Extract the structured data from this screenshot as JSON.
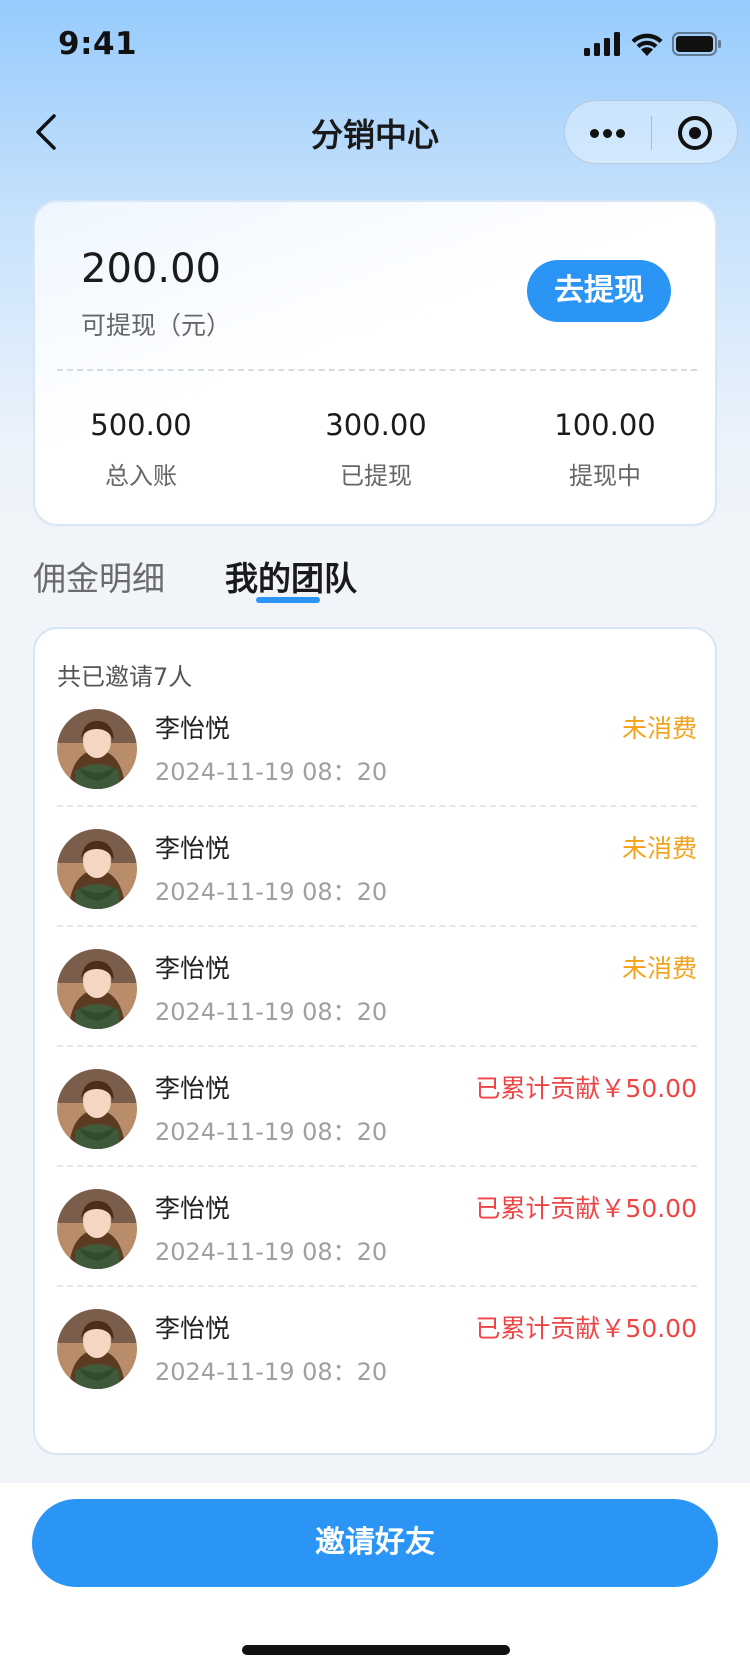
{
  "status_bar": {
    "time": "9:41"
  },
  "nav": {
    "title": "分销中心"
  },
  "balance": {
    "amount": "200.00",
    "label": "可提现（元）",
    "withdraw_button": "去提现",
    "stats": [
      {
        "value": "500.00",
        "label": "总入账"
      },
      {
        "value": "300.00",
        "label": "已提现"
      },
      {
        "value": "100.00",
        "label": "提现中"
      }
    ]
  },
  "tabs": [
    {
      "label": "佣金明细",
      "active": false
    },
    {
      "label": "我的团队",
      "active": true
    }
  ],
  "team": {
    "summary": "共已邀请7人",
    "members": [
      {
        "name": "李怡悦",
        "time": "2024-11-19 08：20",
        "status": "未消费",
        "status_type": "pending"
      },
      {
        "name": "李怡悦",
        "time": "2024-11-19 08：20",
        "status": "未消费",
        "status_type": "pending"
      },
      {
        "name": "李怡悦",
        "time": "2024-11-19 08：20",
        "status": "未消费",
        "status_type": "pending"
      },
      {
        "name": "李怡悦",
        "time": "2024-11-19 08：20",
        "status": "已累计贡献￥50.00",
        "status_type": "contributed"
      },
      {
        "name": "李怡悦",
        "time": "2024-11-19 08：20",
        "status": "已累计贡献￥50.00",
        "status_type": "contributed"
      },
      {
        "name": "李怡悦",
        "time": "2024-11-19 08：20",
        "status": "已累计贡献￥50.00",
        "status_type": "contributed"
      }
    ]
  },
  "invite_button": "邀请好友",
  "colors": {
    "accent": "#2b95f5",
    "pending": "#f5a11a",
    "contributed": "#ee4545"
  }
}
